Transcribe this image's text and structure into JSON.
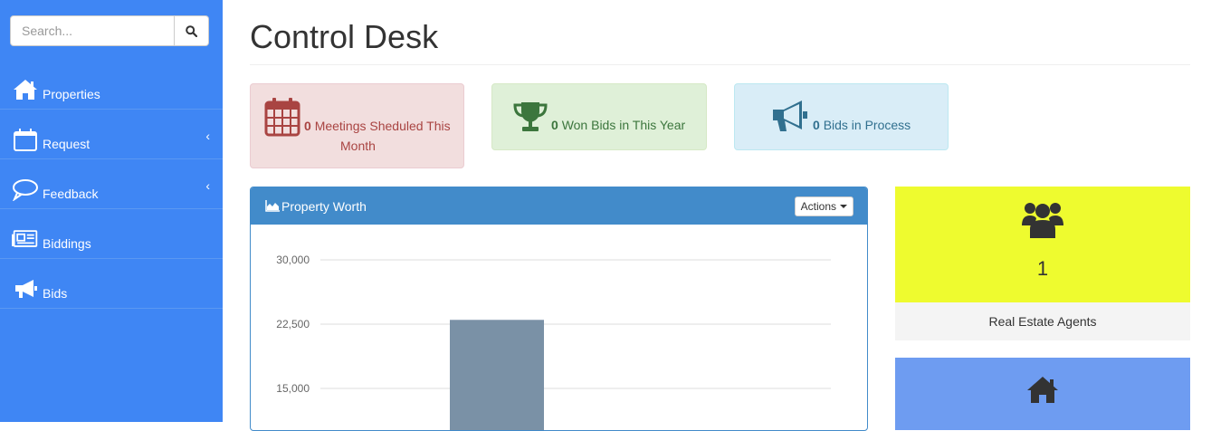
{
  "sidebar": {
    "search": {
      "placeholder": "Search...",
      "value": ""
    },
    "items": [
      {
        "label": "Properties",
        "icon": "home-icon",
        "chevron": ""
      },
      {
        "label": "Request",
        "icon": "calendar-icon",
        "chevron": "‹"
      },
      {
        "label": "Feedback",
        "icon": "speech-bubble-icon",
        "chevron": "‹"
      },
      {
        "label": "Biddings",
        "icon": "newspaper-icon",
        "chevron": ""
      },
      {
        "label": "Bids",
        "icon": "bullhorn-icon",
        "chevron": ""
      }
    ]
  },
  "header": {
    "title": "Control Desk"
  },
  "stats": [
    {
      "count": "0",
      "text_line1": "Meetings Sheduled This",
      "text_line2": "Month",
      "icon": "calendar-icon",
      "color": "#a94442"
    },
    {
      "count": "0",
      "text": "Won Bids in This Year",
      "icon": "trophy-icon",
      "color": "#3c763d"
    },
    {
      "count": "0",
      "text": "Bids in Process",
      "icon": "bullhorn-icon",
      "color": "#31708f"
    }
  ],
  "panel": {
    "title": "Property Worth",
    "actions_label": "Actions"
  },
  "chart_data": {
    "type": "bar",
    "y_ticks": [
      "30,000",
      "22,500",
      "15,000"
    ],
    "categories": [
      ""
    ],
    "values": [
      23000
    ],
    "ylim": [
      0,
      30000
    ],
    "grid": true,
    "bar_color": "#7a91a6"
  },
  "tiles": [
    {
      "icon": "users-icon",
      "count": "1",
      "label": "Real Estate Agents",
      "color": "#eefb2f"
    },
    {
      "icon": "home-icon",
      "color": "#6e9cf1"
    }
  ]
}
